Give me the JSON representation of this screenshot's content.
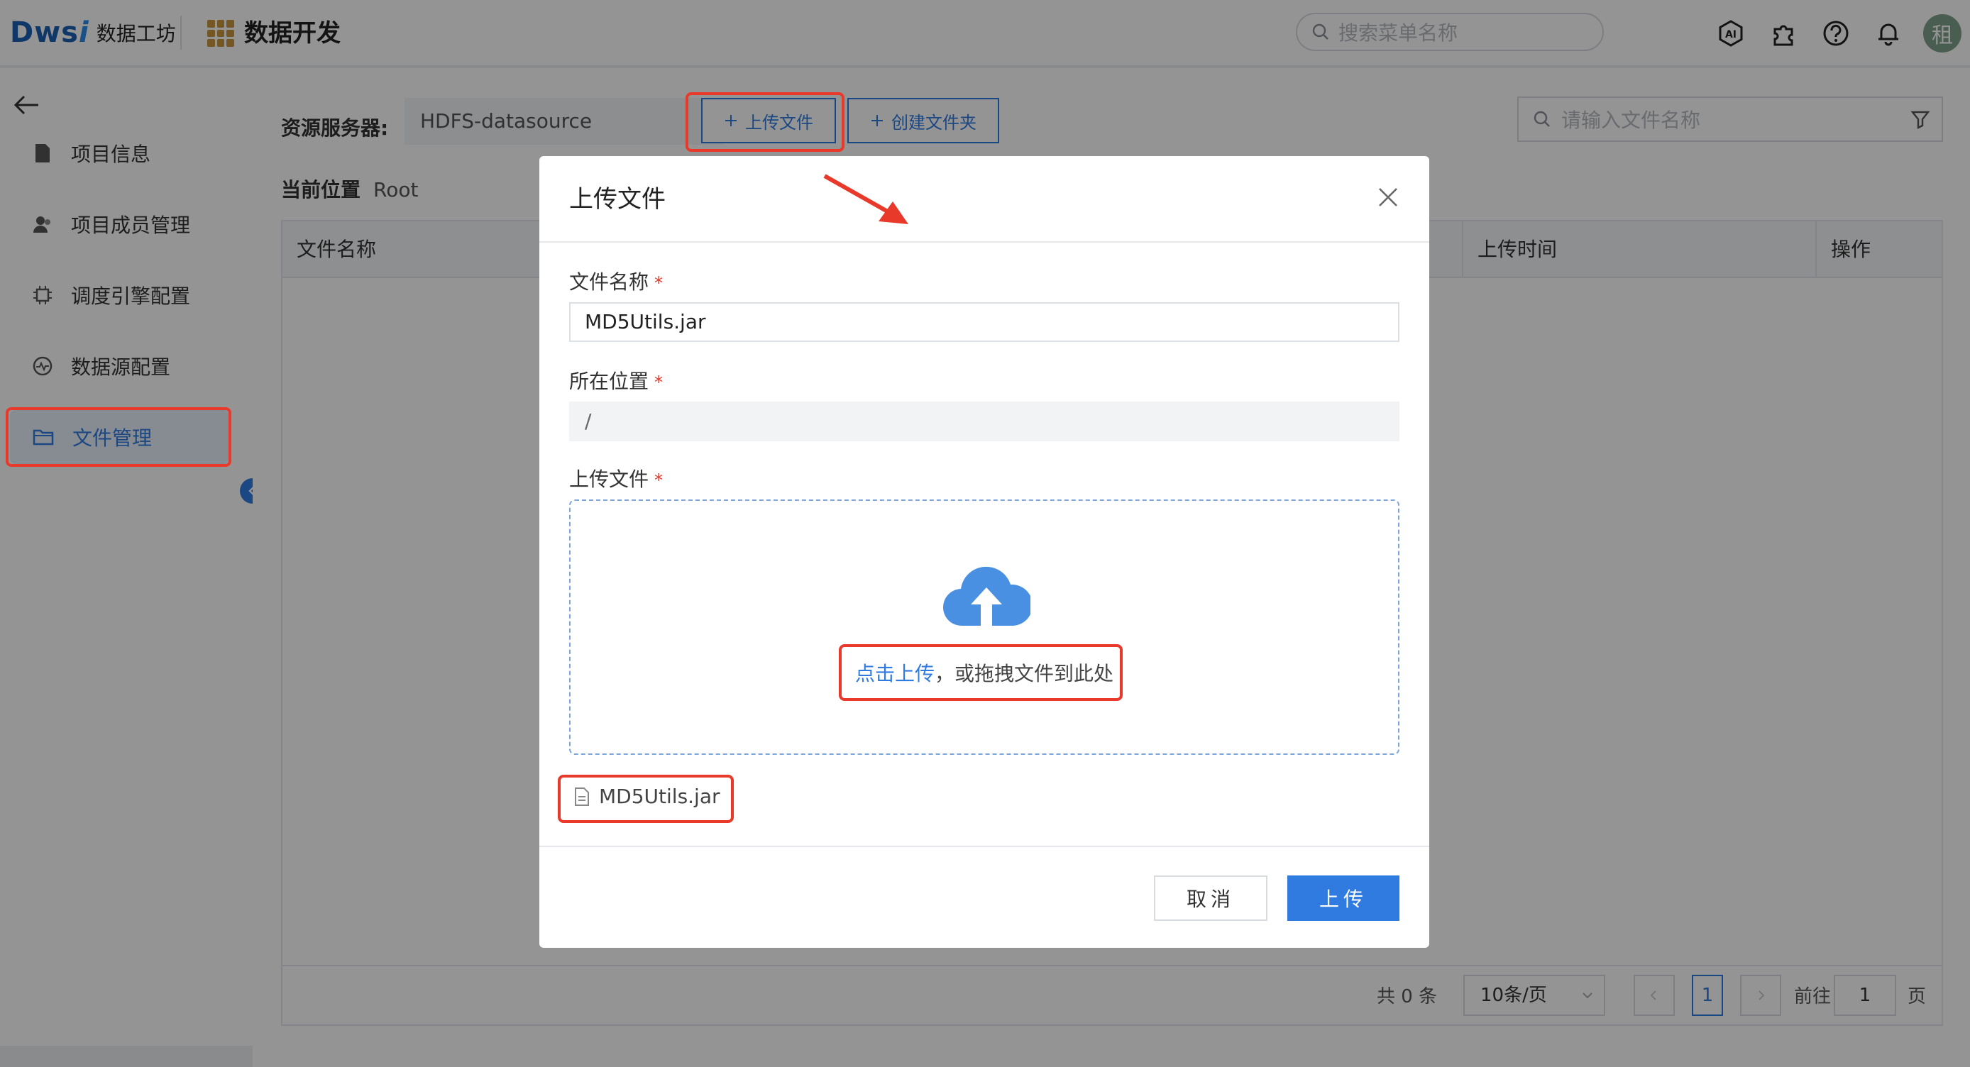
{
  "header": {
    "logo_mark": "Dws",
    "logo_mark_accent": "i",
    "logo_text": "数据工坊",
    "app_title": "数据开发",
    "search_placeholder": "搜索菜单名称",
    "avatar_text": "租"
  },
  "sidebar": {
    "items": [
      {
        "label": "项目信息",
        "icon": "document-icon"
      },
      {
        "label": "项目成员管理",
        "icon": "members-icon"
      },
      {
        "label": "调度引擎配置",
        "icon": "chip-icon"
      },
      {
        "label": "数据源配置",
        "icon": "datasource-icon"
      },
      {
        "label": "文件管理",
        "icon": "folder-icon",
        "active": true
      }
    ]
  },
  "toolbar": {
    "resource_label": "资源服务器:",
    "resource_value": "HDFS-datasource",
    "upload_label": "上传文件",
    "create_folder_label": "创建文件夹",
    "file_search_placeholder": "请输入文件名称"
  },
  "location": {
    "label": "当前位置",
    "value": "Root"
  },
  "table": {
    "columns": [
      "文件名称",
      "上传时间",
      "操作"
    ]
  },
  "pagination": {
    "total": "共 0 条",
    "page_size": "10条/页",
    "current": "1",
    "goto_label": "前往",
    "goto_value": "1",
    "unit": "页"
  },
  "modal": {
    "title": "上传文件",
    "file_name_label": "文件名称",
    "file_name_value": "MD5Utils.jar",
    "location_label": "所在位置",
    "location_value": "/",
    "upload_label": "上传文件",
    "required_mark": "*",
    "dropzone_link": "点击上传",
    "dropzone_text": "，或拖拽文件到此处",
    "selected_file": "MD5Utils.jar",
    "cancel_label": "取消",
    "submit_label": "上传"
  },
  "colors": {
    "accent": "#2f7be0",
    "highlight": "#e8392a"
  }
}
